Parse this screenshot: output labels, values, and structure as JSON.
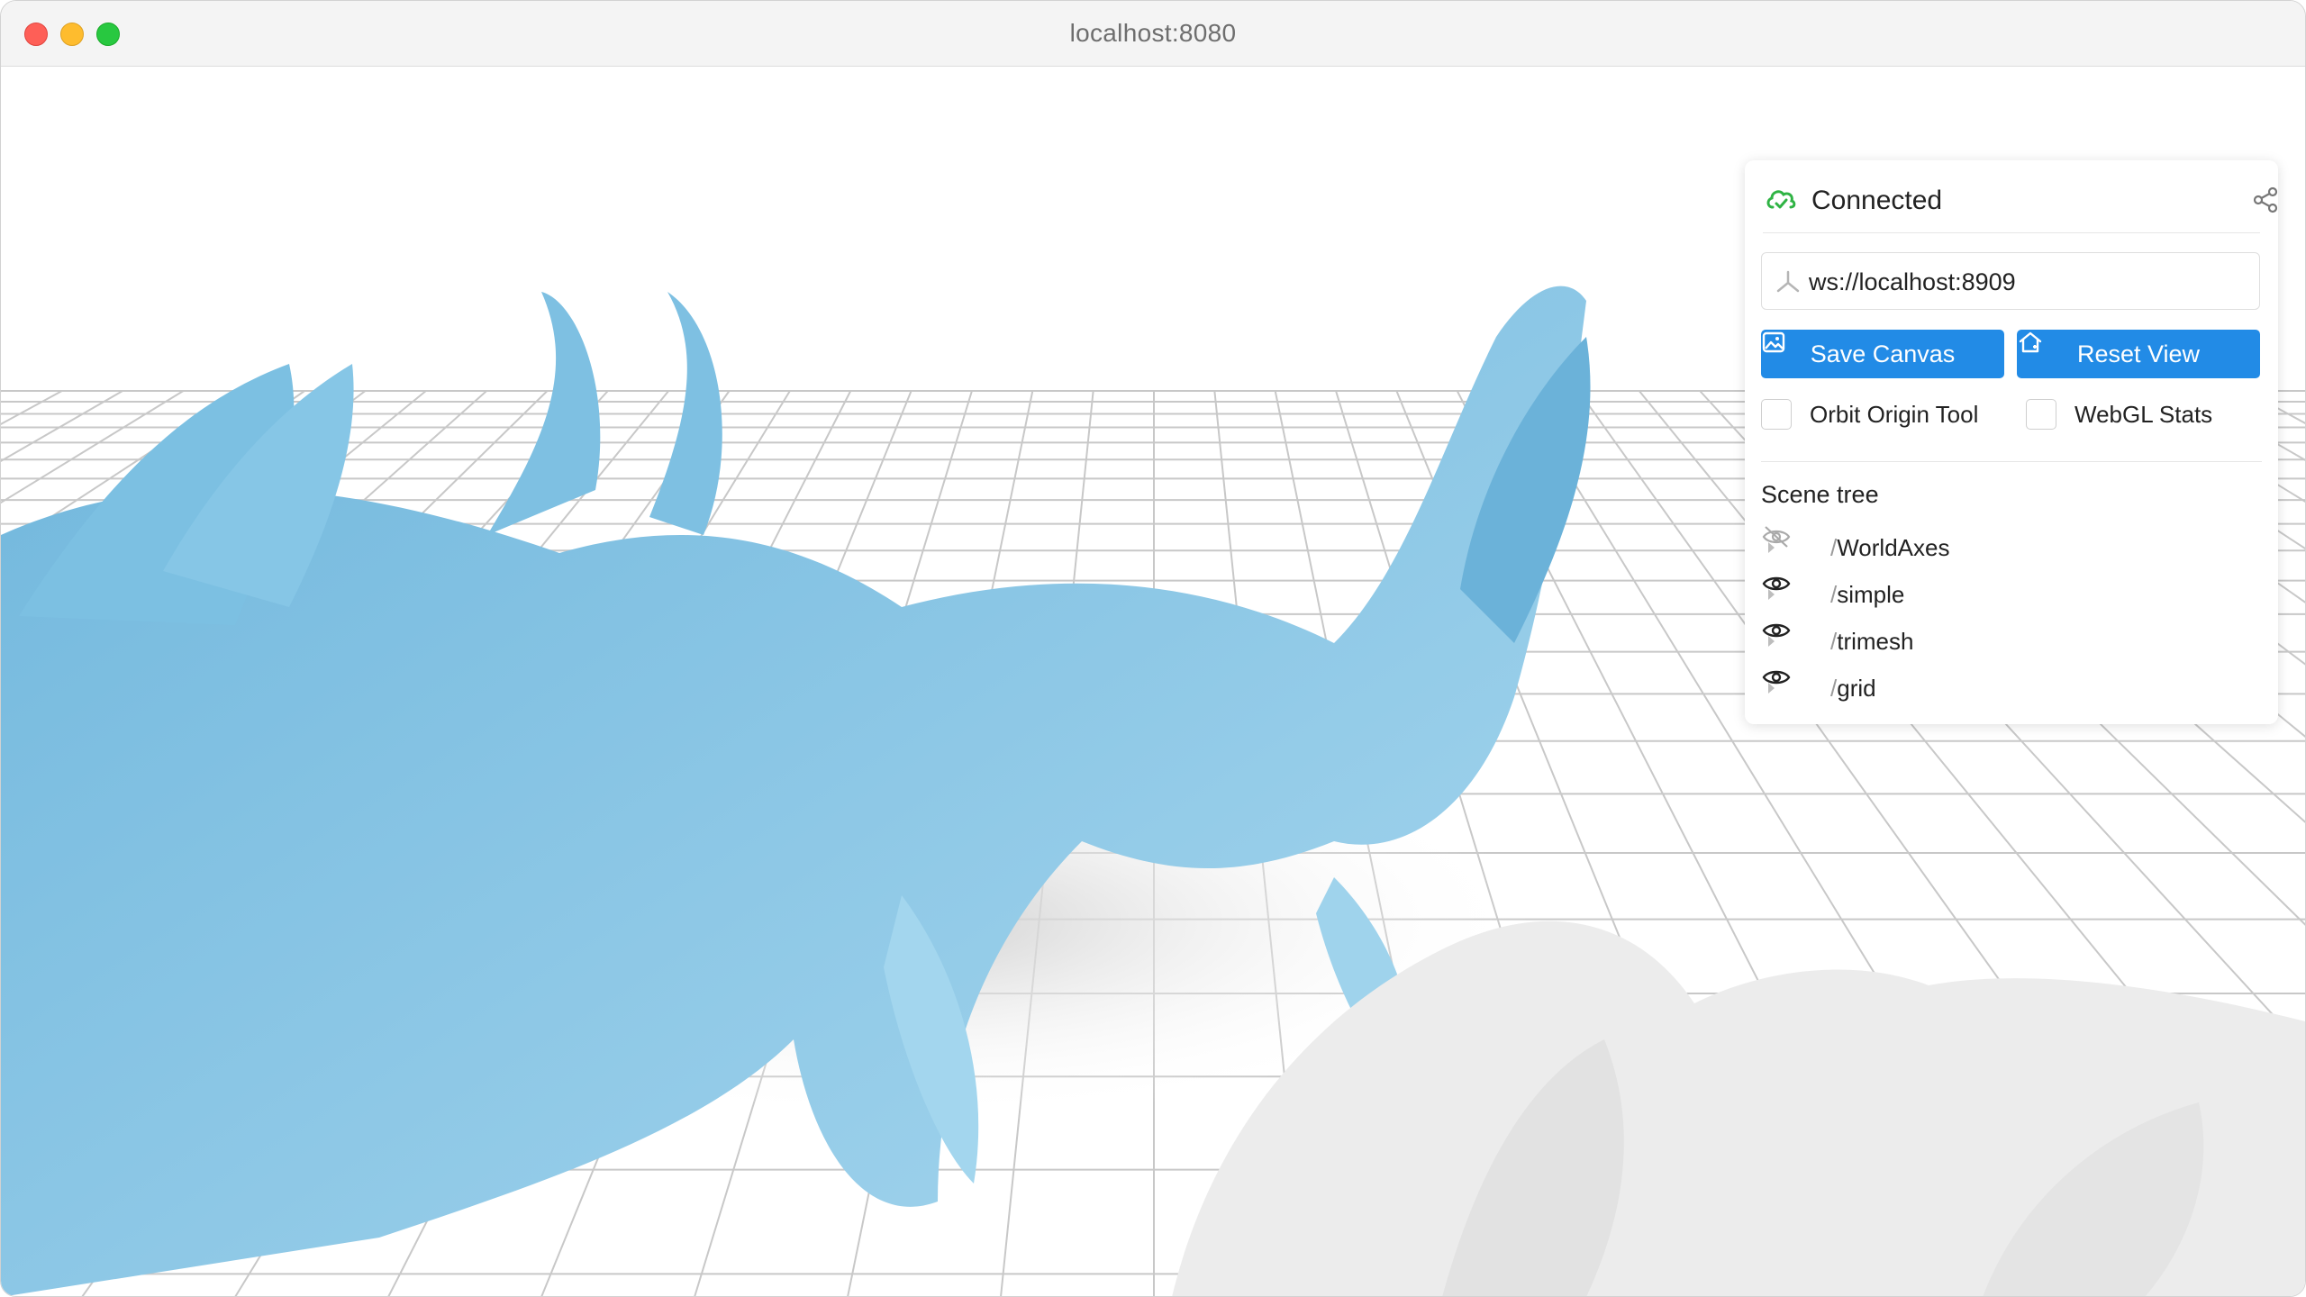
{
  "browser": {
    "url": "localhost:8080"
  },
  "panel": {
    "status": "Connected",
    "server_url": "ws://localhost:8909",
    "save_canvas_label": "Save Canvas",
    "reset_view_label": "Reset View",
    "orbit_origin_label": "Orbit Origin Tool",
    "webgl_stats_label": "WebGL Stats",
    "scene_tree_title": "Scene tree",
    "scene_tree": [
      {
        "name": "WorldAxes",
        "visible": false,
        "icon": "eye-off-icon"
      },
      {
        "name": "simple",
        "visible": true,
        "icon": "eye-icon"
      },
      {
        "name": "trimesh",
        "visible": true,
        "icon": "eye-icon"
      },
      {
        "name": "grid",
        "visible": true,
        "icon": "eye-icon"
      }
    ]
  },
  "colors": {
    "accent": "#228be6",
    "connected": "#2fb344",
    "mesh_blue": "#8cc8e6",
    "mesh_white": "#ececec"
  }
}
